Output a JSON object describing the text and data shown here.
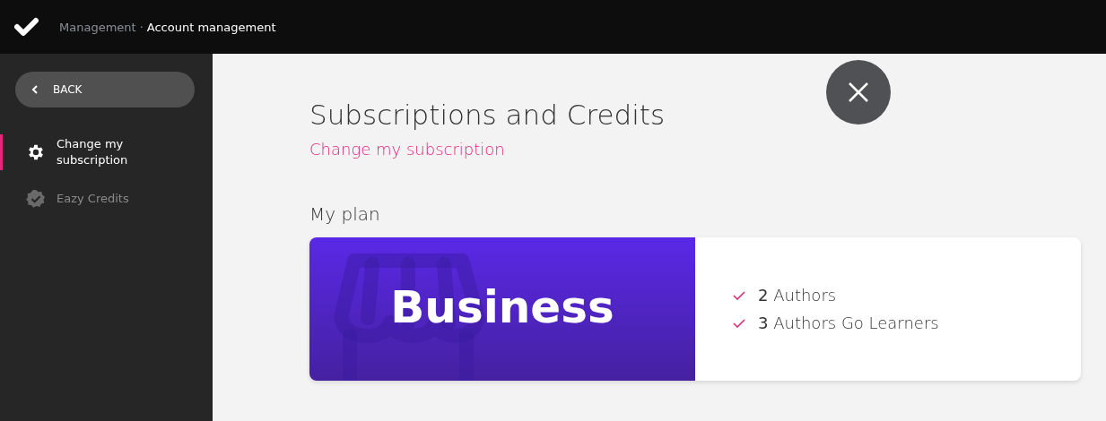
{
  "header": {
    "breadcrumb_parent": "Management",
    "separator": "·",
    "breadcrumb_current": "Account management"
  },
  "sidebar": {
    "back_button": "BACK",
    "items": [
      {
        "label": "Change my subscription",
        "kind": "gear",
        "selected": true
      },
      {
        "label": "Eazy Credits",
        "kind": "badge",
        "selected": false
      }
    ]
  },
  "main": {
    "title": "Subscriptions and Credits",
    "link": "Change my subscription",
    "section_title": "My plan",
    "plan": {
      "name": "Business",
      "features": [
        {
          "text": "**2** Authors"
        },
        {
          "text": "**3** Authors Go Learners"
        }
      ]
    }
  }
}
